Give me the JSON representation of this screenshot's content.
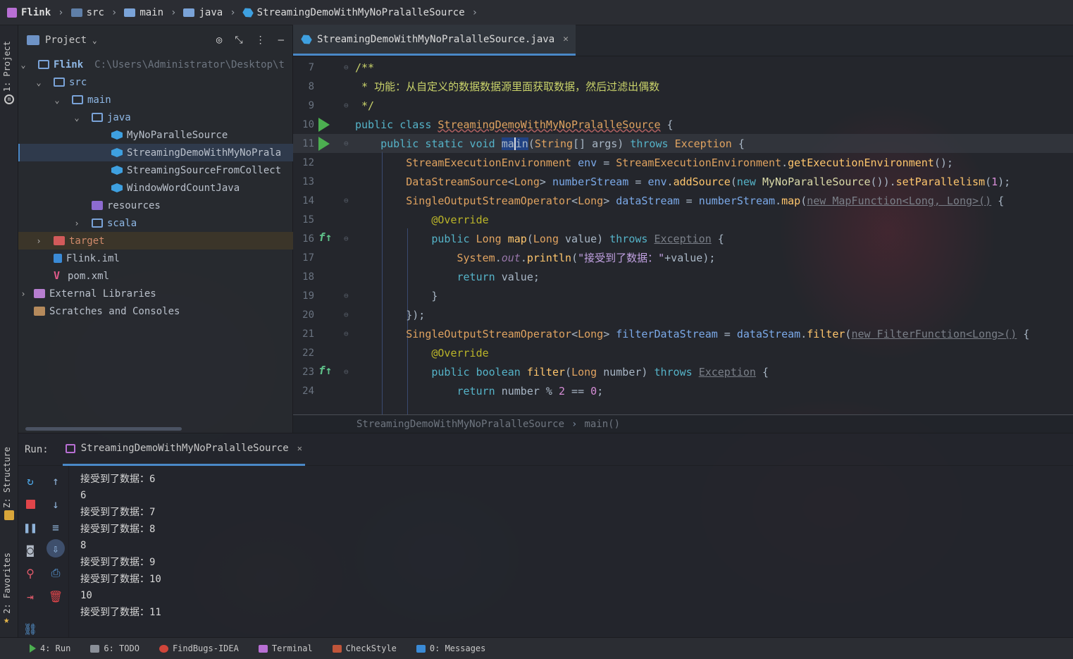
{
  "breadcrumb": [
    "Flink",
    "src",
    "main",
    "java",
    "StreamingDemoWithMyNoPralalleSource"
  ],
  "left_strip": {
    "project_tab": "1: Project",
    "structure_tab": "Z: Structure",
    "favorites_tab": "2: Favorites"
  },
  "project_panel": {
    "title": "Project",
    "tree": [
      {
        "label": "Flink",
        "extra": "C:\\Users\\Administrator\\Desktop\\t",
        "icon": "folder-icon"
      },
      {
        "label": "src",
        "icon": "source-folder-icon"
      },
      {
        "label": "main",
        "icon": "folder-icon"
      },
      {
        "label": "java",
        "icon": "source-folder-icon"
      },
      {
        "label": "MyNoParalleSource",
        "icon": "class-icon"
      },
      {
        "label": "StreamingDemoWithMyNoPrala",
        "icon": "class-icon"
      },
      {
        "label": "StreamingSourceFromCollect",
        "icon": "class-icon"
      },
      {
        "label": "WindowWordCountJava",
        "icon": "class-icon"
      },
      {
        "label": "resources",
        "icon": "resources-folder-icon"
      },
      {
        "label": "scala",
        "icon": "folder-icon"
      },
      {
        "label": "target",
        "icon": "excluded-folder-icon"
      },
      {
        "label": "Flink.iml",
        "icon": "iml-file-icon"
      },
      {
        "label": "pom.xml",
        "icon": "maven-file-icon"
      },
      {
        "label": "External Libraries",
        "icon": "library-icon"
      },
      {
        "label": "Scratches and Consoles",
        "icon": "scratch-icon"
      }
    ]
  },
  "editor": {
    "tab_label": "StreamingDemoWithMyNoPralalleSource.java",
    "line_numbers": [
      "7",
      "8",
      "9",
      "10",
      "11",
      "12",
      "13",
      "14",
      "15",
      "16",
      "17",
      "18",
      "19",
      "20",
      "21",
      "22",
      "23",
      "24"
    ],
    "crumb_class": "StreamingDemoWithMyNoPralalleSource",
    "crumb_method": "main()"
  },
  "run_panel": {
    "label": "Run:",
    "tab_label": "StreamingDemoWithMyNoPralalleSource",
    "console": [
      "接受到了数据：6",
      "6",
      "接受到了数据：7",
      "接受到了数据：8",
      "8",
      "接受到了数据：9",
      "接受到了数据：10",
      "10",
      "接受到了数据：11"
    ]
  },
  "bottom_bar": {
    "run": "4: Run",
    "todo": "6: TODO",
    "findbugs": "FindBugs-IDEA",
    "terminal": "Terminal",
    "checkstyle": "CheckStyle",
    "messages": "0: Messages"
  },
  "colors": {
    "accent": "#4a88c7",
    "run_green": "#4caf50",
    "keyword": "#cc7832",
    "comment": "#c9d26a"
  }
}
